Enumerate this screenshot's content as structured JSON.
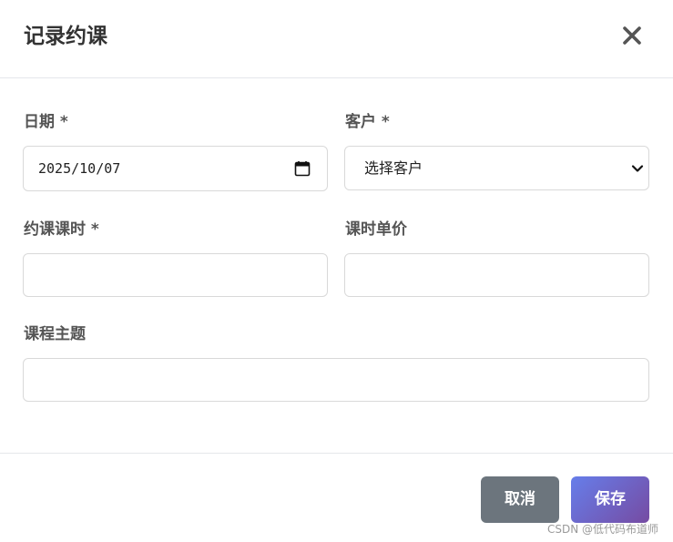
{
  "dialog": {
    "title": "记录约课",
    "close_icon": "close-icon"
  },
  "form": {
    "date": {
      "label": "日期 *",
      "value": "2025/10/07",
      "icon": "calendar-icon"
    },
    "client": {
      "label": "客户 *",
      "selected": "选择客户",
      "icon": "chevron-down-icon"
    },
    "hours": {
      "label": "约课课时 *",
      "value": ""
    },
    "unit_price": {
      "label": "课时单价",
      "value": ""
    },
    "topic": {
      "label": "课程主题",
      "value": ""
    }
  },
  "buttons": {
    "cancel": "取消",
    "save": "保存"
  },
  "colors": {
    "cancel_bg": "#6c757d",
    "save_gradient_start": "#667eea",
    "save_gradient_end": "#764ba2",
    "border": "#d9d9d9"
  },
  "watermark": "CSDN @低代码布道师"
}
